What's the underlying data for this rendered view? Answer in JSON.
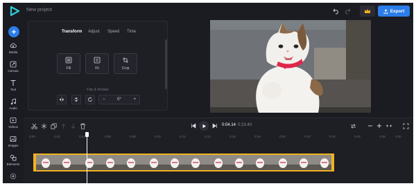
{
  "app": {
    "project_title": "New project",
    "export_label": "Export",
    "accent": "#2b7de9",
    "premium_color": "#f3b21f"
  },
  "sidebar": {
    "items": [
      {
        "label": "Media",
        "icon": "cloud-upload-icon"
      },
      {
        "label": "Canvas",
        "icon": "canvas-resize-icon"
      },
      {
        "label": "Text",
        "icon": "text-icon"
      },
      {
        "label": "Audio",
        "icon": "music-note-icon"
      },
      {
        "label": "Videos",
        "icon": "video-clip-icon"
      },
      {
        "label": "Images",
        "icon": "image-icon"
      },
      {
        "label": "Elements",
        "icon": "shapes-icon"
      }
    ]
  },
  "panel": {
    "tabs": [
      "Transform",
      "Adjust",
      "Speed",
      "Time"
    ],
    "active_tab": "Transform",
    "fit_options": [
      "Fill",
      "Fit",
      "Crop"
    ],
    "flip_rotate_title": "Flip & Rotate",
    "rotation_value": "0°"
  },
  "timeline": {
    "current_time": "0:04.14",
    "total_time": "0:23.40",
    "ruler": [
      "0:00",
      "0:02",
      "0:04",
      "0:06",
      "0:08",
      "0:10",
      "0:12",
      "0:14",
      "0:16",
      "0:18",
      "0:20",
      "0:22",
      "0:24",
      "0:26",
      "0:28",
      "0:30",
      "0:32"
    ]
  }
}
